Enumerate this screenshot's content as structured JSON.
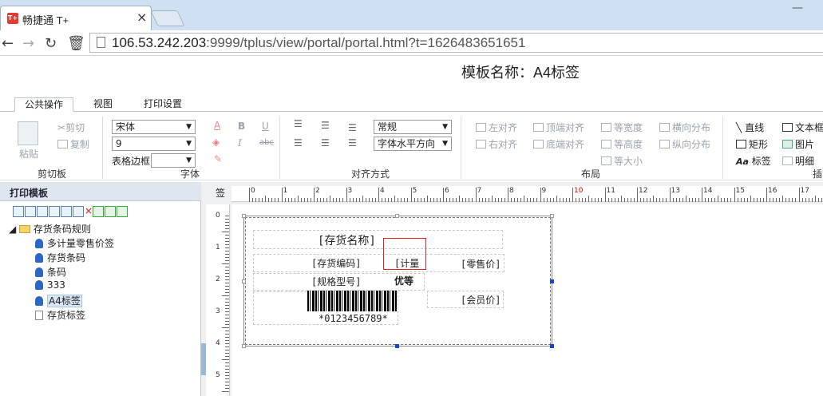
{
  "browser": {
    "tab_title": "畅捷通 T+",
    "tab_icon_text": "T+",
    "url_host": "106.53.242.203",
    "url_rest": ":9999/tplus/view/portal/portal.html?t=1626483651651"
  },
  "template_title": "模板名称：A4标签",
  "ribbon_tabs": [
    "公共操作",
    "视图",
    "打印设置"
  ],
  "ribbon": {
    "clipboard": {
      "paste": "粘贴",
      "cut": "剪切",
      "copy": "复制",
      "label": "剪切板"
    },
    "font": {
      "family": "宋体",
      "size": "9",
      "border_label": "表格边框",
      "border_value": "",
      "label": "字体",
      "bold": "B",
      "italic": "I",
      "underline": "U",
      "strike": "abc",
      "color": "A"
    },
    "align": {
      "style": "常规",
      "horizontal": "字体水平方向",
      "label": "对齐方式"
    },
    "layout": {
      "left_align": "左对齐",
      "right_align": "右对齐",
      "top_align": "顶端对齐",
      "bottom_align": "底端对齐",
      "same_width": "等宽度",
      "same_height": "等高度",
      "same_size": "等大小",
      "h_distribute": "横向分布",
      "v_distribute": "纵向分布",
      "label": "布局"
    },
    "insert": {
      "line": "直线",
      "rect": "矩形",
      "label_tool": "标签",
      "textbox": "文本框",
      "image": "图片",
      "detail": "明细",
      "label": "插"
    }
  },
  "sidebar": {
    "title": "打印模板",
    "root": "存货条码规则",
    "items": [
      "多计量零售价签",
      "存货条码",
      "条码",
      "333",
      "A4标签",
      "存货标签"
    ],
    "selected": "A4标签"
  },
  "ruler": {
    "corner": "签",
    "h_numbers": [
      "0",
      "1",
      "2",
      "3",
      "4",
      "5",
      "6",
      "7",
      "8",
      "9",
      "10",
      "11",
      "12",
      "13",
      "14",
      "15",
      "16",
      "17"
    ],
    "v_numbers": [
      "0",
      "1",
      "2",
      "3",
      "4",
      "5"
    ]
  },
  "canvas": {
    "name_field": "[存货名称]",
    "code_field": "[存货编码]",
    "unit_field": "[计量",
    "retail_field": "[零售价]",
    "spec_field": "[规格型号]",
    "grade_field": "优等",
    "member_field": "[会员价]",
    "barcode_text": "*0123456789*"
  },
  "colors": {
    "accent": "#e53a2f",
    "selection": "#e02020",
    "tab_bg": "#cfe0f3"
  }
}
